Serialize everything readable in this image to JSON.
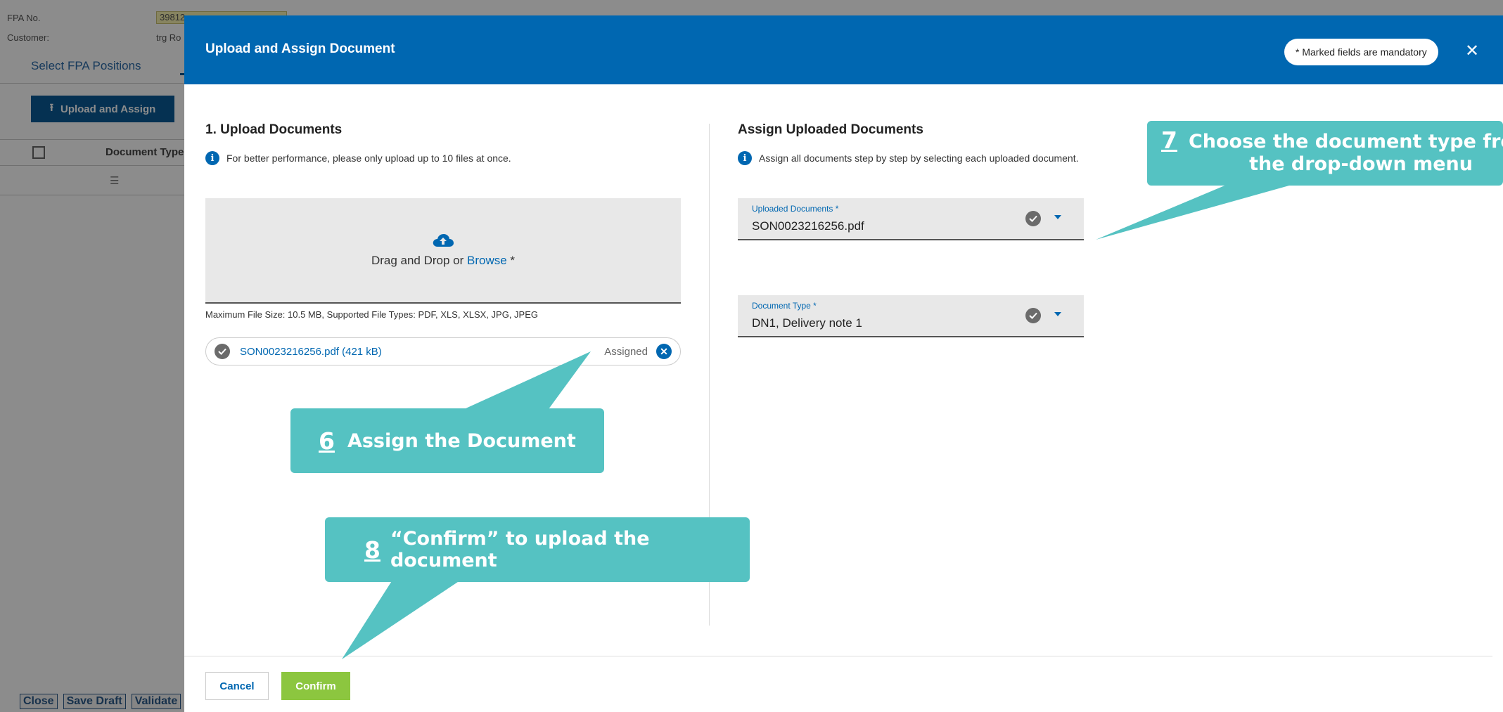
{
  "background": {
    "fpa_no_label": "FPA No.",
    "fpa_no_value": "39812",
    "customer_label": "Customer:",
    "customer_value": "trg Ro",
    "tab_label": "Select FPA Positions",
    "upload_button_label": "Upload and Assign",
    "table_col_header": "Document Type",
    "bottom_buttons": [
      "Close",
      "Save Draft",
      "Validate"
    ]
  },
  "dialog": {
    "title": "Upload and Assign Document",
    "mandatory_note": "* Marked fields are mandatory",
    "close_icon": "close-icon"
  },
  "upload": {
    "title": "1. Upload Documents",
    "info_text": "For better performance, please only upload up to 10 files at once.",
    "drop_prefix": "Drag and Drop or ",
    "browse_label": "Browse",
    "drop_suffix": " *",
    "file_info": "Maximum File Size: 10.5 MB, Supported File Types: PDF, XLS, XLSX, JPG, JPEG",
    "file": {
      "name": "SON0023216256.pdf (421 kB)",
      "status": "Assigned"
    }
  },
  "assign": {
    "title": "Assign Uploaded Documents",
    "info_text": "Assign all documents step by step by selecting each uploaded document.",
    "uploaded_documents": {
      "label": "Uploaded Documents *",
      "value": "SON0023216256.pdf"
    },
    "document_type": {
      "label": "Document Type *",
      "value": "DN1, Delivery note 1"
    }
  },
  "footer": {
    "cancel_label": "Cancel",
    "confirm_label": "Confirm"
  },
  "callouts": [
    {
      "number": "6",
      "text": "Assign the Document"
    },
    {
      "number": "7",
      "text": "Choose the document type from",
      "text2": "the drop-down menu"
    },
    {
      "number": "8",
      "text": "“Confirm” to upload the document"
    }
  ],
  "colors": {
    "header_blue": "#0067b1",
    "callout_teal": "#55c2c2",
    "confirm_green": "#8cc63f"
  }
}
